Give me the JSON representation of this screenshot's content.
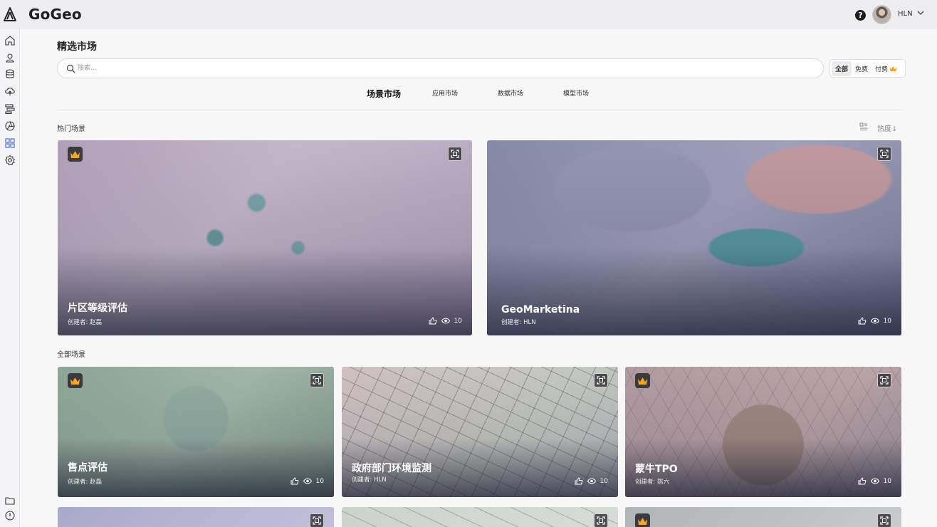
{
  "app": {
    "brand": "GoGeo",
    "username": "HLN"
  },
  "sidebar": {
    "items": [
      {
        "icon": "home-icon"
      },
      {
        "icon": "location-user-icon"
      },
      {
        "icon": "database-icon"
      },
      {
        "icon": "cloud-upload-icon"
      },
      {
        "icon": "workflow-icon"
      },
      {
        "icon": "aperture-icon"
      },
      {
        "icon": "grid-apps-icon",
        "active": true
      },
      {
        "icon": "settings-icon"
      }
    ],
    "bottom": [
      {
        "icon": "folder-icon"
      },
      {
        "icon": "info-icon"
      }
    ]
  },
  "page": {
    "title": "精选市场"
  },
  "search": {
    "placeholder": "搜索..."
  },
  "filter": {
    "all": "全部",
    "free": "免费",
    "paid": "付费"
  },
  "tabs": [
    {
      "label": "场景市场",
      "active": true
    },
    {
      "label": "应用市场"
    },
    {
      "label": "数据市场"
    },
    {
      "label": "模型市场"
    }
  ],
  "hot": {
    "label": "热门场景",
    "sort_label": "热度↓",
    "cards": [
      {
        "title": "片区等级评估",
        "creator": "创建者: 赵磊",
        "views": "10",
        "paid": true
      },
      {
        "title": "GeoMarketina",
        "creator": "创建者: HLN",
        "views": "10",
        "paid": false
      }
    ]
  },
  "all": {
    "label": "全部场景",
    "cards": [
      {
        "title": "售点评估",
        "creator": "创建者: 赵磊",
        "views": "10",
        "paid": true
      },
      {
        "title": "政府部门环境监测",
        "creator": "创建者: HLN",
        "views": "10",
        "paid": false
      },
      {
        "title": "蒙牛TPO",
        "creator": "创建者: 陈六",
        "views": "10",
        "paid": true
      },
      {
        "paid": false
      },
      {
        "paid": false
      },
      {
        "paid": true
      }
    ]
  },
  "colors": {
    "accent": "#f5a623",
    "badge_bg": "#3a3a3f",
    "topbar_bg": "#eeeef1"
  }
}
